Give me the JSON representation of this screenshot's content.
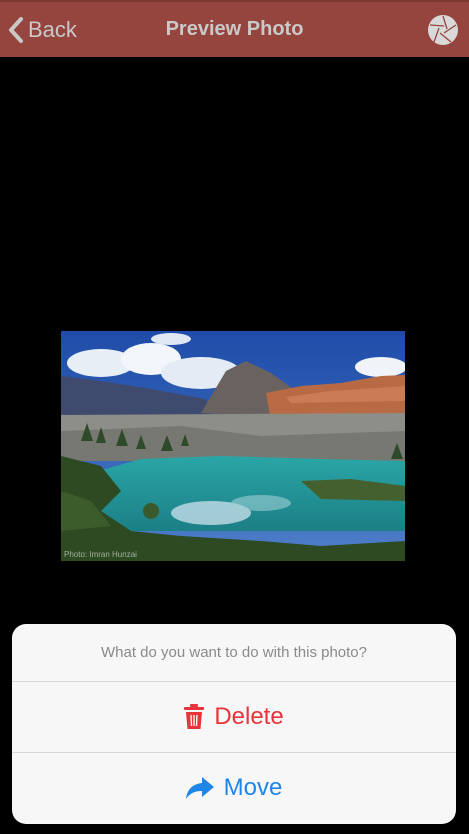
{
  "header": {
    "back_label": "Back",
    "title": "Preview Photo",
    "back_icon": "chevron-left-icon",
    "shutter_icon": "camera-shutter-icon",
    "background": "#95453d"
  },
  "photo": {
    "credit": "Photo: Imran Hunzai"
  },
  "action_sheet": {
    "message": "What do you want to do with this photo?",
    "delete_label": "Delete",
    "delete_icon": "trash-icon",
    "delete_color": "#e5343a",
    "move_label": "Move",
    "move_icon": "share-arrow-icon",
    "move_color": "#1f86e8"
  }
}
